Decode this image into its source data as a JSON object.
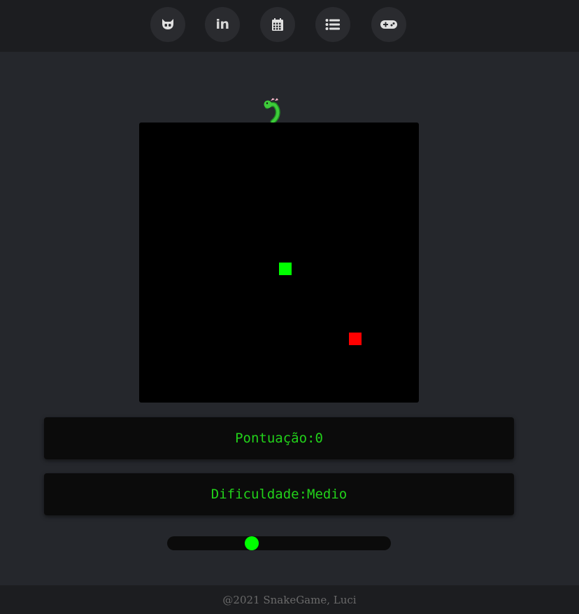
{
  "nav": {
    "items": [
      {
        "icon": "github-icon"
      },
      {
        "icon": "linkedin-icon",
        "label": "in"
      },
      {
        "icon": "calendar-icon"
      },
      {
        "icon": "list-icon"
      },
      {
        "icon": "gamepad-icon"
      }
    ]
  },
  "game": {
    "logo_icon": "snake-icon",
    "grid_size": 20,
    "snake": [
      {
        "col": 10,
        "row": 10
      }
    ],
    "food": {
      "col": 15,
      "row": 15
    },
    "colors": {
      "snake": "#00ff00",
      "food": "#ff0000",
      "board": "#000000",
      "accent": "#22d11a"
    }
  },
  "score": {
    "text": "Pontuação:0"
  },
  "difficulty": {
    "text": "Dificuldade:Medio",
    "slider_fraction": 0.37
  },
  "footer": {
    "text": "@2021 SnakeGame, Luci"
  }
}
